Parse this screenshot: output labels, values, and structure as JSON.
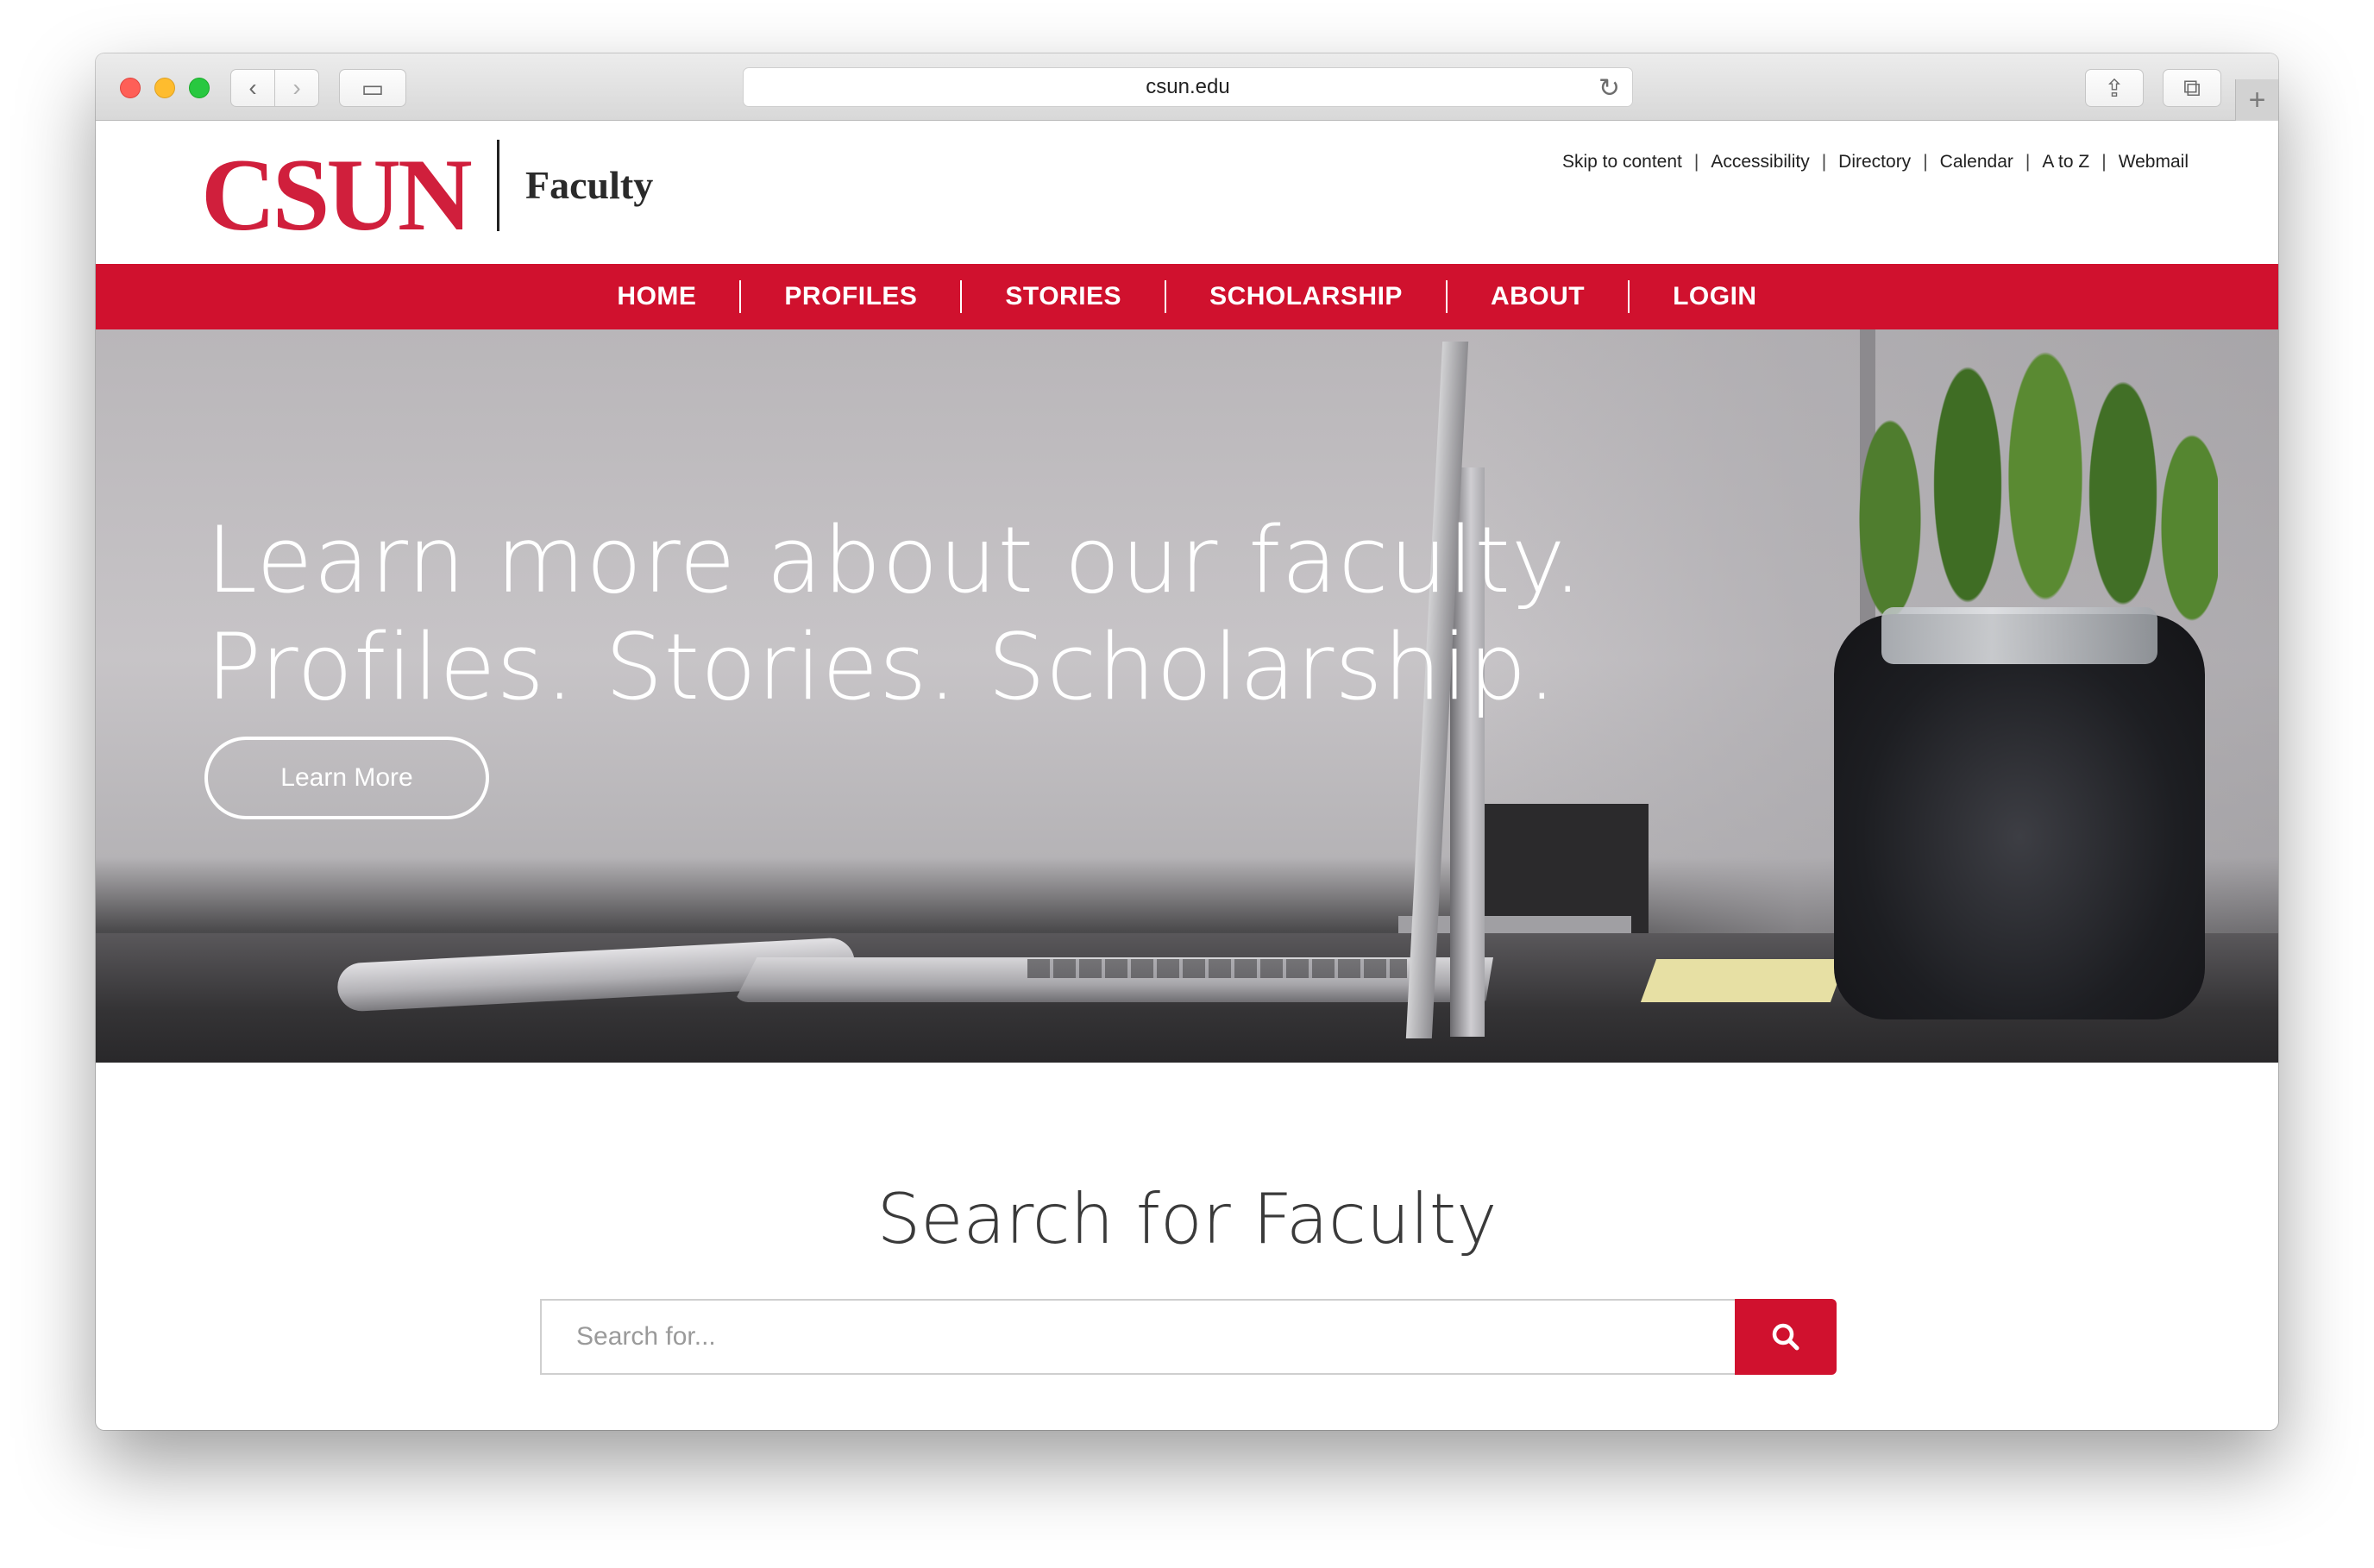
{
  "browser": {
    "url": "csun.edu",
    "buttons": {
      "back": "‹",
      "forward": "›",
      "sidebar": "▭",
      "reload": "↻",
      "share": "⇪",
      "tabs": "⧉",
      "new_tab": "+"
    }
  },
  "header": {
    "logo_text": "CSUN",
    "site_name": "Faculty",
    "utility_links": [
      "Skip to content",
      "Accessibility",
      "Directory",
      "Calendar",
      "A to Z",
      "Webmail"
    ]
  },
  "nav": {
    "items": [
      "HOME",
      "PROFILES",
      "STORIES",
      "SCHOLARSHIP",
      "ABOUT",
      "LOGIN"
    ]
  },
  "hero": {
    "line1": "Learn more about our faculty.",
    "line2": "Profiles. Stories. Scholarship.",
    "button_label": "Learn More"
  },
  "search": {
    "title": "Search for Faculty",
    "placeholder": "Search for..."
  },
  "colors": {
    "brand_red": "#d0112e",
    "logo_red": "#d01f3c"
  },
  "icons": {
    "search_button": "search-icon"
  }
}
